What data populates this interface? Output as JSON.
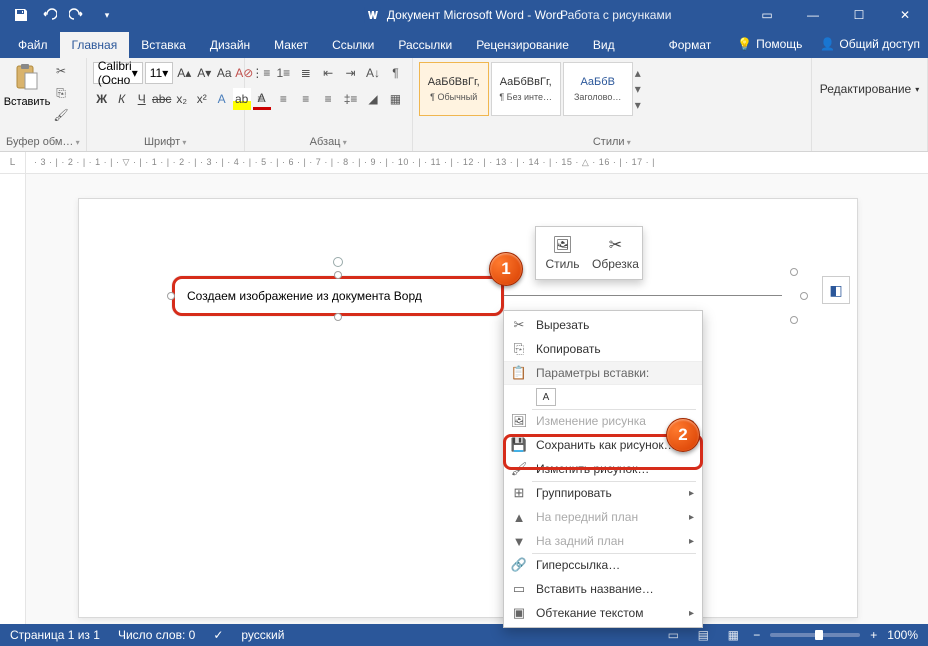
{
  "title": "Документ Microsoft Word - Word",
  "pictureTools": "Работа с рисунками",
  "tabs": {
    "file": "Файл",
    "home": "Главная",
    "insert": "Вставка",
    "design": "Дизайн",
    "layout": "Макет",
    "references": "Ссылки",
    "mailings": "Рассылки",
    "review": "Рецензирование",
    "view": "Вид",
    "format": "Формат",
    "help": "Помощь",
    "share": "Общий доступ"
  },
  "ribbon": {
    "paste": "Вставить",
    "clipboard": "Буфер обм…",
    "fontName": "Calibri (Осно",
    "fontSize": "11",
    "fontGroup": "Шрифт",
    "paraGroup": "Абзац",
    "stylesGroup": "Стили",
    "editGroup": "Редактирование",
    "styles": {
      "normal": {
        "sample": "АаБбВвГг,",
        "name": "¶ Обычный"
      },
      "nospace": {
        "sample": "АаБбВвГг,",
        "name": "¶ Без инте…"
      },
      "heading1": {
        "sample": "АаБбВ",
        "name": "Заголово…"
      }
    },
    "bold": "Ж",
    "italic": "К",
    "underline": "Ч",
    "strike": "abc",
    "sub": "x₂",
    "sup": "x²"
  },
  "ruler": "· 3 · | · 2 · | · 1 · | · ▽ · | · 1 · | · 2 · | · 3 · | · 4 · | · 5 · | · 6 · | · 7 · | · 8 · | · 9 · | · 10 · | · 11 · | · 12 · | · 13 · | · 14 · | · 15 · △ · 16 · | · 17 · |",
  "textObject": "Создаем изображение из документа Ворд",
  "miniToolbar": {
    "style": "Стиль",
    "crop": "Обрезка"
  },
  "contextMenu": {
    "cut": "Вырезать",
    "copy": "Копировать",
    "pasteHeader": "Параметры вставки:",
    "changePicture": "Изменение рисунка",
    "saveAsPicture": "Сохранить как рисунок…",
    "editPicture": "Изменить рисунок…",
    "group": "Группировать",
    "bringFront": "На передний план",
    "sendBack": "На задний план",
    "hyperlink": "Гиперссылка…",
    "insertCaption": "Вставить название…",
    "textWrap": "Обтекание текстом"
  },
  "status": {
    "page": "Страница 1 из 1",
    "words": "Число слов: 0",
    "lang": "русский",
    "zoom": "100%"
  },
  "callouts": {
    "one": "1",
    "two": "2"
  }
}
